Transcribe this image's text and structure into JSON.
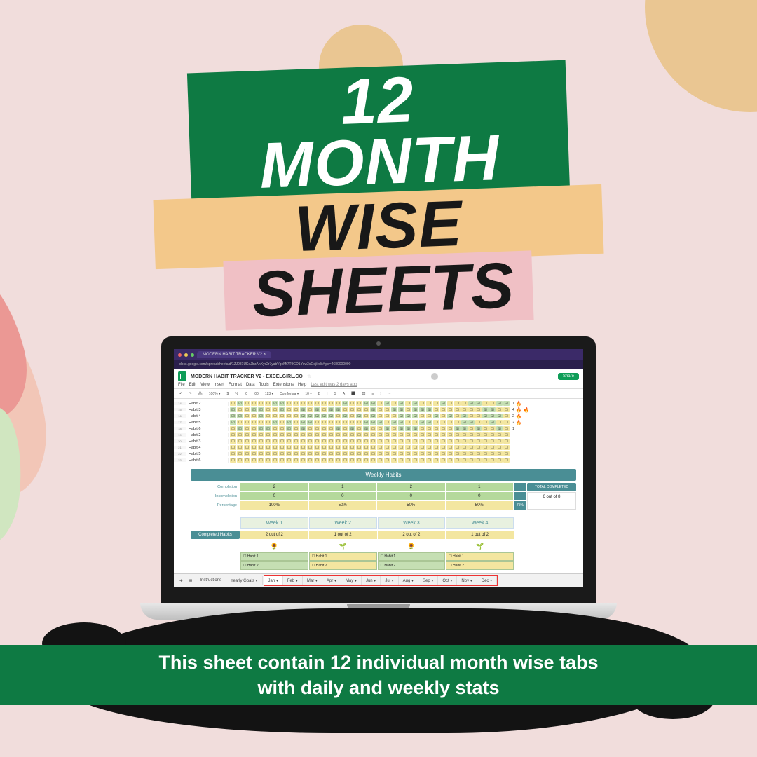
{
  "title": {
    "row1": "12 MONTH",
    "row2": "WISE",
    "row3": "SHEETS"
  },
  "browser": {
    "tab": "MODERN HABIT TRACKER V2 ×",
    "url": "docs.google.com/spreadsheets/d/1ZJ081UKeJInrAnXyc2r7yabVgoMt7T9GD1Yxw3cGcj/edit#gid=4680000090"
  },
  "doc": {
    "title": "MODERN HABIT TRACKER V2 - EXCELGIRL.CO",
    "star": "☆",
    "menus": [
      "File",
      "Edit",
      "View",
      "Insert",
      "Format",
      "Data",
      "Tools",
      "Extensions",
      "Help"
    ],
    "last_edit": "Last edit was 2 days ago",
    "share": "Share",
    "toolbar": [
      "↶",
      "↷",
      "🖨",
      "100% ▾",
      "$",
      "%",
      ".0",
      ".00",
      "123 ▾",
      "Comfortaa ▾",
      "10 ▾",
      "B",
      "I",
      "S",
      "A",
      "⬛",
      "田",
      "≡",
      "⫶",
      "⋯"
    ]
  },
  "habits": [
    "Habit 2",
    "Habit 3",
    "Habit 4",
    "Habit 5",
    "Habit 6",
    "Habit 2",
    "Habit 3",
    "Habit 4",
    "Habit 5",
    "Habit 6"
  ],
  "streaks": [
    {
      "n": "1",
      "f": 1
    },
    {
      "n": "4",
      "f": 2
    },
    {
      "n": "2",
      "f": 1
    },
    {
      "n": "2",
      "f": 1
    },
    {
      "n": "1",
      "f": 0
    },
    {
      "n": "",
      "f": 0
    },
    {
      "n": "",
      "f": 0
    },
    {
      "n": "",
      "f": 0
    },
    {
      "n": "",
      "f": 0
    },
    {
      "n": "",
      "f": 0
    }
  ],
  "weekly": {
    "title": "Weekly Habits",
    "rows": [
      "Completion",
      "Incompletion",
      "Percentage"
    ],
    "cols": [
      [
        "2",
        "0",
        "100%"
      ],
      [
        "1",
        "0",
        "50%"
      ],
      [
        "2",
        "0",
        "50%"
      ],
      [
        "1",
        "0",
        "50%"
      ]
    ],
    "total_pct": "75%",
    "total_completed_head": "TOTAL COMPLETED",
    "total_completed_val": "6 out of 8",
    "weeks": [
      "Week 1",
      "Week 2",
      "Week 3",
      "Week 4"
    ],
    "completed_label": "Completed Habits",
    "completed_vals": [
      "2 out of 2",
      "1 out of 2",
      "2 out of 2",
      "1 out of 2"
    ],
    "plants": [
      "🌻",
      "🌱",
      "🌻",
      "🌱"
    ],
    "mini": [
      "Habit 1",
      "Habit 2"
    ]
  },
  "tabs": {
    "plus": "+",
    "burger": "≡",
    "left": [
      "Instructions",
      "Yearly Goals ▾"
    ],
    "months": [
      "Jan ▾",
      "Feb ▾",
      "Mar ▾",
      "Apr ▾",
      "May ▾",
      "Jun ▾",
      "Jul ▾",
      "Aug ▾",
      "Sep ▾",
      "Oct ▾",
      "Nov ▾",
      "Dec ▾"
    ]
  },
  "banner": "This sheet contain 12 individual month wise tabs\nwith daily and weekly stats"
}
